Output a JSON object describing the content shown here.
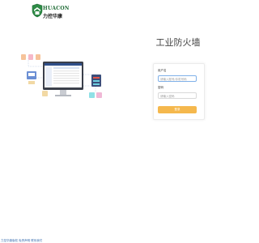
{
  "brand": {
    "name_en": "HUACON",
    "name_cn": "力控华康",
    "accent": "#1e6b35"
  },
  "page": {
    "title": "工业防火墙"
  },
  "login": {
    "username_label": "用户名",
    "username_placeholder": "请输入账号/手机号码",
    "password_label": "密码",
    "password_placeholder": "请输入密码",
    "submit_label": "登录",
    "button_color": "#f5b84d"
  },
  "footer": {
    "text": "力控华康版权 免责声明 联系我们"
  }
}
